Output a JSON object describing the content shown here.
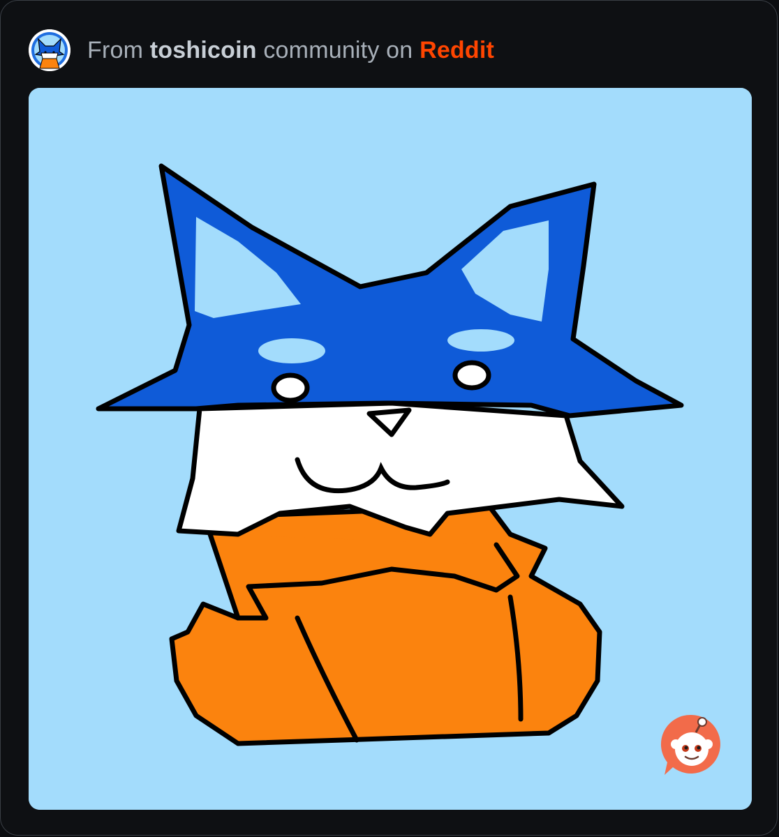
{
  "header": {
    "prefix": "From",
    "community": "toshicoin",
    "middle": "community on",
    "platform": "Reddit"
  },
  "colors": {
    "background": "#0e1013",
    "border": "#3a3f46",
    "muted_text": "#a8b0b9",
    "community_text": "#c8cfd6",
    "reddit_orange": "#ff4500",
    "sky_blue": "#a3dcfc",
    "fox_blue": "#0f5bd8",
    "fox_orange": "#fb830e"
  },
  "icons": {
    "avatar": "toshi-fox-avatar-icon",
    "badge": "reddit-logo-icon"
  }
}
